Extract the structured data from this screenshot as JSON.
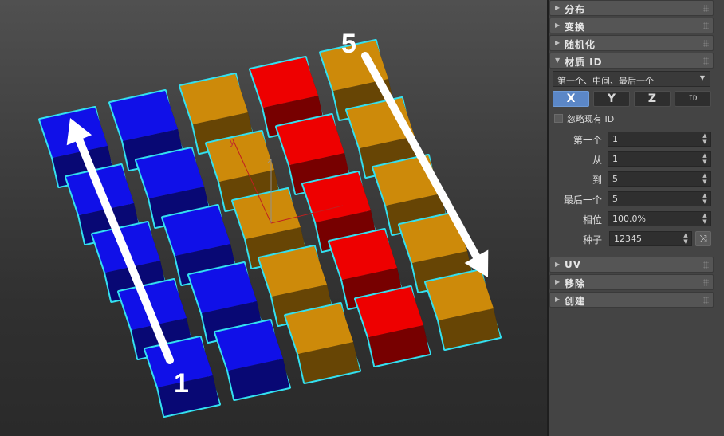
{
  "viewport": {
    "label_start": "1",
    "label_end": "5",
    "axis_y": "y",
    "axis_z": "z"
  },
  "colors": {
    "blue": "#1010e8",
    "red": "#ee0000",
    "orange": "#cd8a0a",
    "outline": "#33e0f0",
    "accent": "#5b87c7"
  },
  "panel": {
    "rollouts": [
      {
        "title": "分布",
        "expanded": false
      },
      {
        "title": "变换",
        "expanded": false
      },
      {
        "title": "随机化",
        "expanded": false
      },
      {
        "title": "材质 ID",
        "expanded": true
      },
      {
        "title": "UV",
        "expanded": false
      },
      {
        "title": "移除",
        "expanded": false
      },
      {
        "title": "创建",
        "expanded": false
      }
    ],
    "material": {
      "mode": "第一个、中间、最后一个",
      "axes": [
        {
          "label": "X",
          "active": true
        },
        {
          "label": "Y",
          "active": false
        },
        {
          "label": "Z",
          "active": false
        },
        {
          "label": "ID",
          "active": false
        }
      ],
      "ignore_label": "忽略现有 ID",
      "fields": [
        {
          "label": "第一个",
          "value": "1"
        },
        {
          "label": "从",
          "value": "1"
        },
        {
          "label": "到",
          "value": "5"
        },
        {
          "label": "最后一个",
          "value": "5"
        },
        {
          "label": "相位",
          "value": "100.0%"
        }
      ],
      "seed_label": "种子",
      "seed_value": "12345"
    }
  }
}
